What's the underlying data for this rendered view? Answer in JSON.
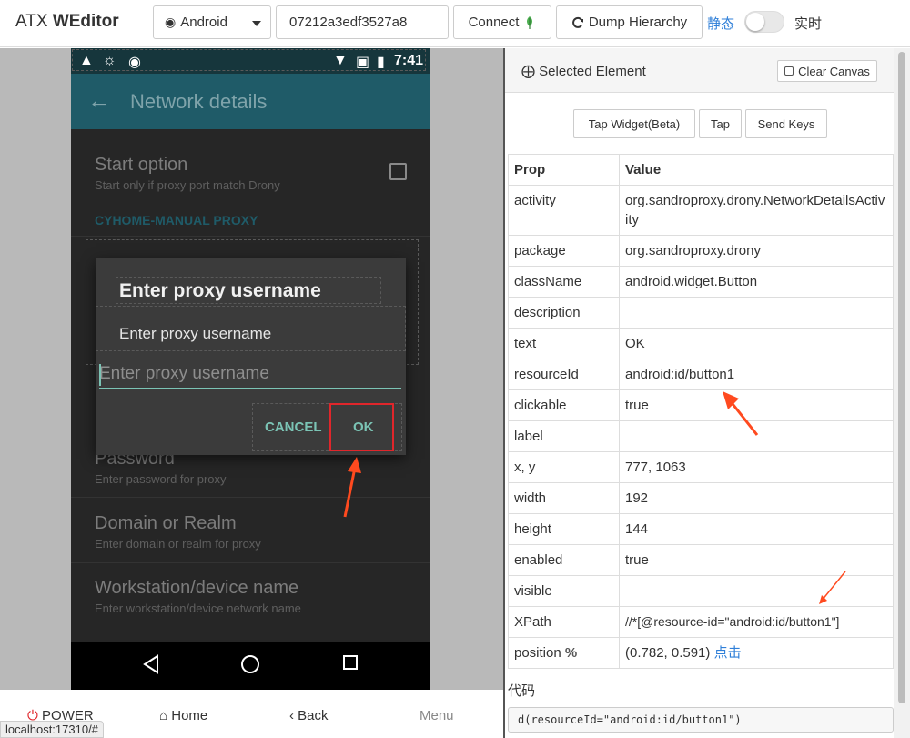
{
  "navbar": {
    "brand_prefix": "ATX",
    "brand_name": "WEditor",
    "platform": "Android",
    "serial": "07212a3edf3527a8",
    "connect_label": "Connect",
    "dump_label": "Dump Hierarchy",
    "mode_static": "静态",
    "mode_live": "实时"
  },
  "device": {
    "clock": "7:41",
    "app_title": "Network details",
    "start_option_title": "Start option",
    "start_option_summary": "Start only if proxy port match Drony",
    "section_header": "CYHOME-MANUAL PROXY",
    "password_title": "Password",
    "password_summary": "Enter password for proxy",
    "domain_title": "Domain or Realm",
    "domain_summary": "Enter domain or realm for proxy",
    "workstation_title": "Workstation/device name",
    "workstation_summary": "Enter workstation/device network name",
    "dialog": {
      "title": "Enter proxy username",
      "message": "Enter proxy username",
      "input_placeholder": "Enter proxy username",
      "cancel_label": "CANCEL",
      "ok_label": "OK"
    }
  },
  "bottom_bar": {
    "power_label": "POWER",
    "home_label": "Home",
    "back_label": "Back",
    "menu_label": "Menu",
    "url": "localhost:17310/#"
  },
  "inspector": {
    "title": "Selected Element",
    "clear_canvas_label": "Clear Canvas",
    "tap_widget_label": "Tap Widget(Beta)",
    "tap_label": "Tap",
    "send_keys_label": "Send Keys",
    "header_prop": "Prop",
    "header_value": "Value",
    "rows": [
      {
        "prop": "activity",
        "value": "org.sandroproxy.drony.NetworkDetailsActivity"
      },
      {
        "prop": "package",
        "value": "org.sandroproxy.drony"
      },
      {
        "prop": "className",
        "value": "android.widget.Button"
      },
      {
        "prop": "description",
        "value": ""
      },
      {
        "prop": "text",
        "value": "OK"
      },
      {
        "prop": "resourceId",
        "value": "android:id/button1"
      },
      {
        "prop": "clickable",
        "value": "true"
      },
      {
        "prop": "label",
        "value": ""
      },
      {
        "prop": "x, y",
        "value": "777, 1063"
      },
      {
        "prop": "width",
        "value": "192"
      },
      {
        "prop": "height",
        "value": "144"
      },
      {
        "prop": "enabled",
        "value": "true"
      },
      {
        "prop": "visible",
        "value": ""
      },
      {
        "prop": "XPath",
        "value": "//*[@resource-id=\"android:id/button1\"]"
      },
      {
        "prop": "position",
        "value": "(0.782, 0.591)"
      }
    ],
    "position_suffix": "%",
    "click_link": "点击",
    "code_label": "代码",
    "code": "d(resourceId=\"android:id/button1\")"
  },
  "colors": {
    "accent": "#2f7fd8",
    "highlight_red": "#e0262b",
    "android_teal": "#7bc4b5",
    "appbar": "#1f5b68"
  }
}
